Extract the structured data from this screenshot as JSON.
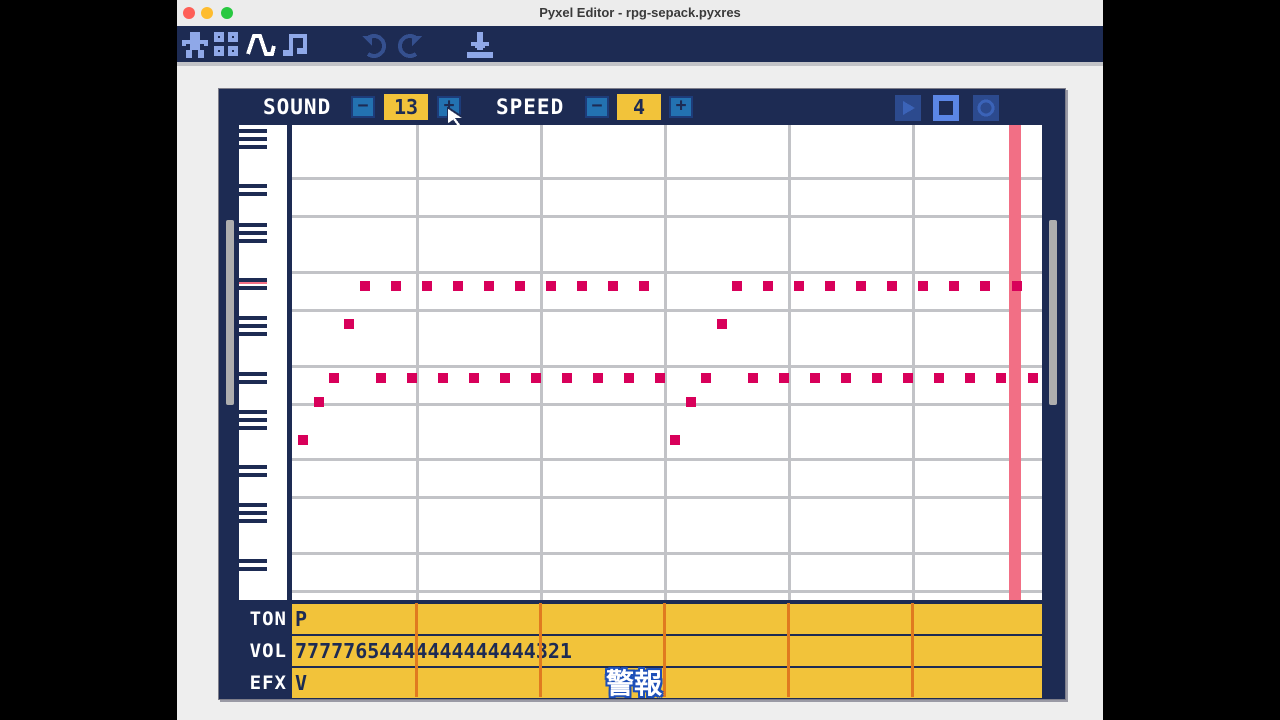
{
  "window": {
    "title": "Pyxel Editor - rpg-sepack.pyxres"
  },
  "toolbar": {
    "icons": [
      "image-editor-icon",
      "tilemap-editor-icon",
      "sound-editor-icon",
      "music-editor-icon",
      "undo-icon",
      "redo-icon",
      "save-icon"
    ]
  },
  "header": {
    "sound_label": "SOUND",
    "sound_value": "13",
    "speed_label": "SPEED",
    "speed_value": "4",
    "minus": "−",
    "plus": "+"
  },
  "params": {
    "tone_label": "TON",
    "tone_value": "P",
    "volume_label": "VOL",
    "volume_value": "77777654444444444444321",
    "effect_label": "EFX",
    "effect_value": "V"
  },
  "subtitle": "警報"
}
